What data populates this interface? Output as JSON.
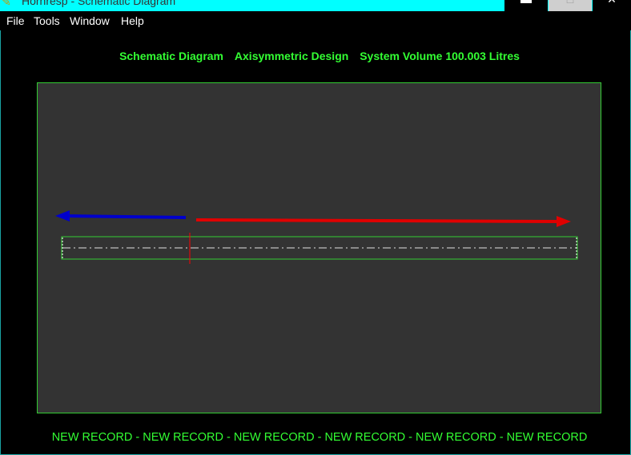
{
  "window": {
    "title": "Hornresp - Schematic Diagram",
    "icon": "pencil-icon",
    "buttons": {
      "minimize_glyph": "▬",
      "maximize_glyph": "□",
      "close_glyph": "✕"
    }
  },
  "menu": {
    "items": [
      {
        "label": "File"
      },
      {
        "label": "Tools"
      },
      {
        "label": "Window"
      },
      {
        "label": "Help"
      }
    ]
  },
  "heading": {
    "part1": "Schematic Diagram",
    "part2": "Axisymmetric Design",
    "part3": "System Volume 100.003 Litres"
  },
  "footer": {
    "text": "NEW RECORD - NEW RECORD - NEW RECORD - NEW RECORD - NEW RECORD - NEW RECORD"
  },
  "colors": {
    "titlebar": "#00ffff",
    "text_green": "#33ff33",
    "panel_bg": "#333333",
    "left_arrow": "#0000cc",
    "right_arrow": "#e00000",
    "marker": "#ff0000"
  }
}
